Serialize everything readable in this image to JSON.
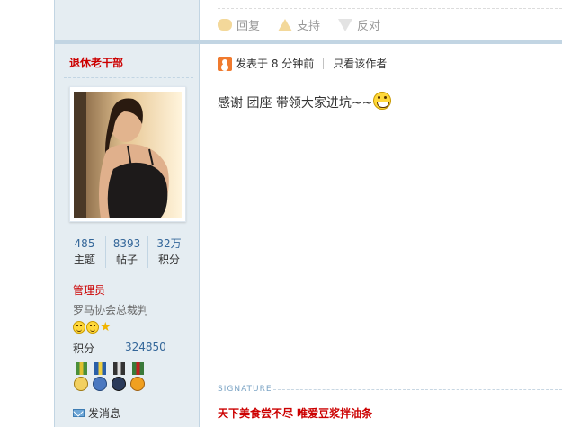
{
  "previous_post": {
    "actions": [
      {
        "label": "回复",
        "icon": "reply-icon"
      },
      {
        "label": "支持",
        "icon": "thumbs-up-icon"
      },
      {
        "label": "反对",
        "icon": "thumbs-down-icon"
      }
    ]
  },
  "author": {
    "username": "退休老干部",
    "avatar": "avatar-photo",
    "stats": [
      {
        "value": "485",
        "label": "主题"
      },
      {
        "value": "8393",
        "label": "帖子"
      },
      {
        "value": "32万",
        "label": "积分"
      }
    ],
    "group": "管理员",
    "custom_title": "罗马协会总裁判",
    "points_label": "积分",
    "points_value": "324850",
    "send_message": "发消息"
  },
  "post": {
    "posted_text": "发表于 8 分钟前",
    "only_author": "只看该作者",
    "content": "感谢  团座  带领大家进坑~~"
  },
  "signature": {
    "label": "SIGNATURE",
    "text": "天下美食尝不尽   唯爱豆浆拌油条"
  },
  "colors": {
    "sidebar_bg": "#e5edf2",
    "divider": "#c2d5e3",
    "accent_red": "#cc0000",
    "link_blue": "#336699"
  }
}
